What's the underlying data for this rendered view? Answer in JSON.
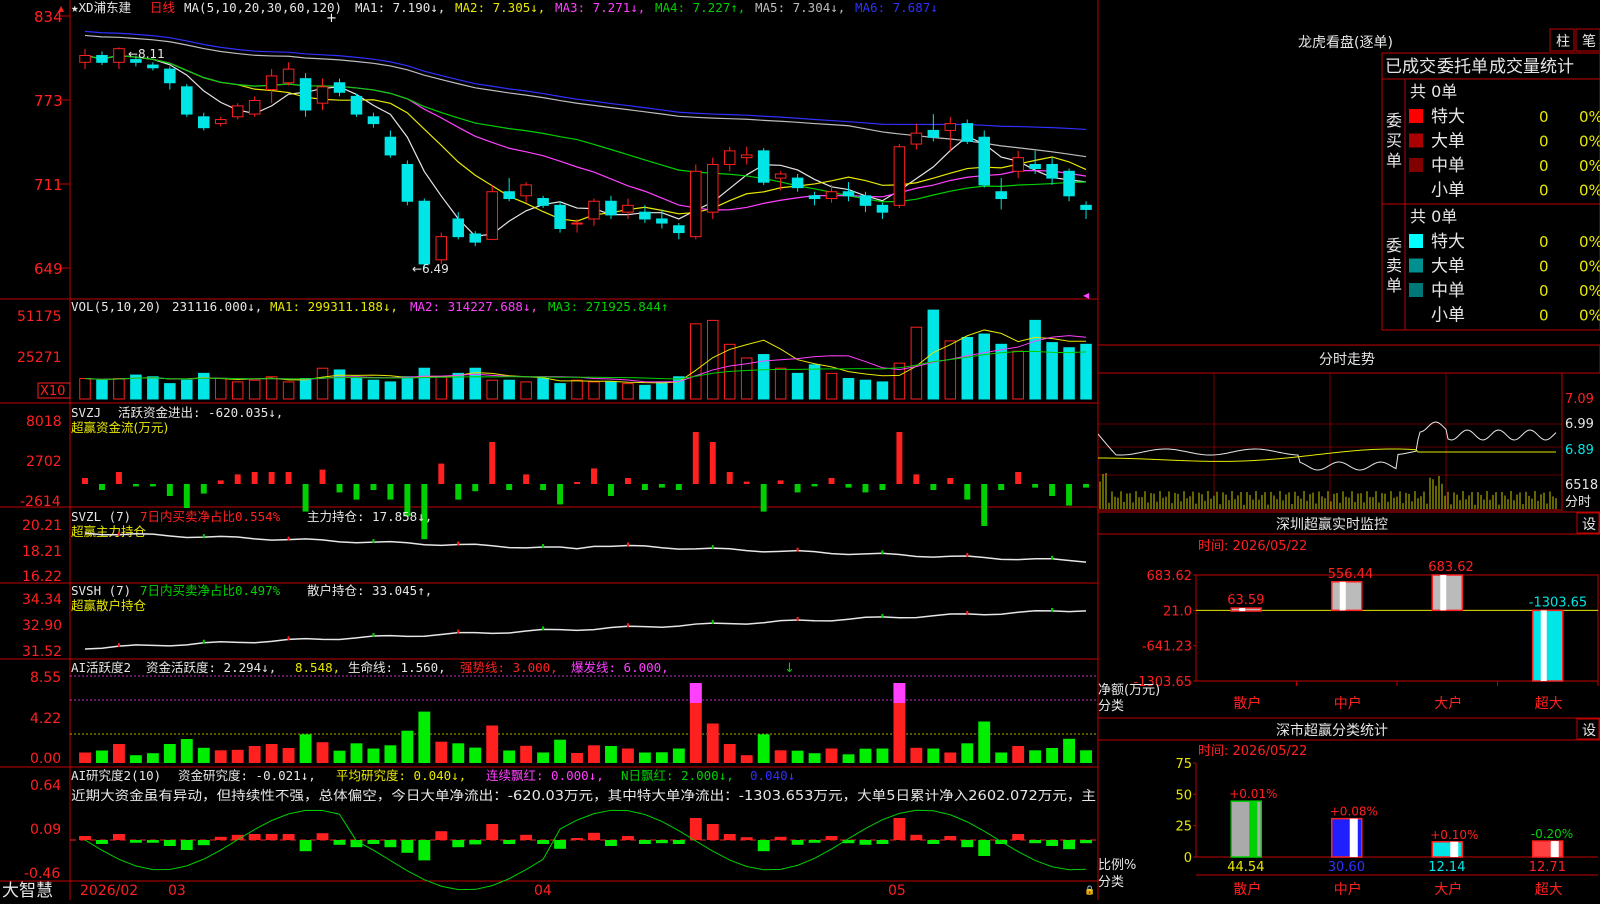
{
  "app": {
    "brand": "大智慧"
  },
  "colors": {
    "up": "#ff2020",
    "down": "#00e5e5",
    "grid": "#c00000",
    "bg": "#000000",
    "white": "#e6e6e6",
    "yellow": "#e8e800",
    "magenta": "#ff40ff",
    "green": "#00d000",
    "blue": "#3030ff",
    "gray": "#bdbdbd"
  },
  "kline": {
    "header": {
      "name": "★XD浦东建",
      "period": "日线",
      "ma_label": "MA(5,10,20,30,60,120)",
      "ma1": "MA1: 7.190↓,",
      "ma2": "MA2: 7.305↓,",
      "ma3": "MA3: 7.271↓,",
      "ma4": "MA4: 7.227↑,",
      "ma5": "MA5: 7.304↓,",
      "ma6": "MA6: 7.687↓"
    },
    "price_axis": [
      "834",
      "773",
      "711",
      "649"
    ],
    "high_label": "←8.11",
    "low_label": "←6.49",
    "months": [
      "2026/02",
      "03",
      "04",
      "05"
    ],
    "candles": [
      [
        8.0,
        8.1,
        7.95,
        8.05
      ],
      [
        8.05,
        8.08,
        7.98,
        8.0
      ],
      [
        8.0,
        8.11,
        7.95,
        8.1
      ],
      [
        8.02,
        8.05,
        7.97,
        8.0
      ],
      [
        7.98,
        8.0,
        7.94,
        7.96
      ],
      [
        7.95,
        7.97,
        7.8,
        7.85
      ],
      [
        7.82,
        7.84,
        7.6,
        7.62
      ],
      [
        7.6,
        7.63,
        7.5,
        7.52
      ],
      [
        7.55,
        7.6,
        7.53,
        7.58
      ],
      [
        7.6,
        7.7,
        7.58,
        7.68
      ],
      [
        7.62,
        7.75,
        7.6,
        7.72
      ],
      [
        7.8,
        7.95,
        7.7,
        7.9
      ],
      [
        7.85,
        8.0,
        7.83,
        7.95
      ],
      [
        7.88,
        7.92,
        7.6,
        7.65
      ],
      [
        7.7,
        7.88,
        7.65,
        7.82
      ],
      [
        7.85,
        7.88,
        7.75,
        7.78
      ],
      [
        7.75,
        7.77,
        7.6,
        7.62
      ],
      [
        7.6,
        7.63,
        7.52,
        7.55
      ],
      [
        7.45,
        7.5,
        7.3,
        7.32
      ],
      [
        7.25,
        7.28,
        6.95,
        6.98
      ],
      [
        6.98,
        7.0,
        6.49,
        6.52
      ],
      [
        6.55,
        6.75,
        6.52,
        6.72
      ],
      [
        6.85,
        6.9,
        6.7,
        6.72
      ],
      [
        6.74,
        6.76,
        6.65,
        6.68
      ],
      [
        6.7,
        7.1,
        6.7,
        7.05
      ],
      [
        7.05,
        7.15,
        6.98,
        7.0
      ],
      [
        7.02,
        7.12,
        6.97,
        7.1
      ],
      [
        7.0,
        7.02,
        6.93,
        6.95
      ],
      [
        6.95,
        6.98,
        6.75,
        6.78
      ],
      [
        6.82,
        6.85,
        6.75,
        6.82
      ],
      [
        6.85,
        7.0,
        6.8,
        6.98
      ],
      [
        6.98,
        7.02,
        6.85,
        6.88
      ],
      [
        6.9,
        7.0,
        6.85,
        6.95
      ],
      [
        6.9,
        6.95,
        6.82,
        6.85
      ],
      [
        6.85,
        6.92,
        6.78,
        6.82
      ],
      [
        6.8,
        6.82,
        6.7,
        6.75
      ],
      [
        6.72,
        7.25,
        6.7,
        7.2
      ],
      [
        6.9,
        7.3,
        6.85,
        7.25
      ],
      [
        7.25,
        7.38,
        7.2,
        7.35
      ],
      [
        7.3,
        7.38,
        7.25,
        7.32
      ],
      [
        7.35,
        7.37,
        7.1,
        7.12
      ],
      [
        7.15,
        7.2,
        7.06,
        7.18
      ],
      [
        7.15,
        7.18,
        7.05,
        7.08
      ],
      [
        7.02,
        7.05,
        6.95,
        7.0
      ],
      [
        7.0,
        7.1,
        6.97,
        7.05
      ],
      [
        7.05,
        7.12,
        6.98,
        7.02
      ],
      [
        7.02,
        7.05,
        6.9,
        6.95
      ],
      [
        6.95,
        6.97,
        6.85,
        6.9
      ],
      [
        6.95,
        7.4,
        6.93,
        7.38
      ],
      [
        7.4,
        7.55,
        7.36,
        7.48
      ],
      [
        7.5,
        7.62,
        7.42,
        7.45
      ],
      [
        7.5,
        7.6,
        7.35,
        7.55
      ],
      [
        7.55,
        7.58,
        7.4,
        7.42
      ],
      [
        7.45,
        7.5,
        7.08,
        7.1
      ],
      [
        7.05,
        7.15,
        6.92,
        7.0
      ],
      [
        7.2,
        7.35,
        7.15,
        7.3
      ],
      [
        7.25,
        7.35,
        7.18,
        7.22
      ],
      [
        7.25,
        7.3,
        7.1,
        7.15
      ],
      [
        7.2,
        7.22,
        6.98,
        7.02
      ],
      [
        6.95,
        6.98,
        6.85,
        6.92
      ]
    ]
  },
  "vol": {
    "header": {
      "label": "VOL(5,10,20)",
      "value": "231116.000↓,",
      "ma1": "MA1: 299311.188↓,",
      "ma2": "MA2: 314227.688↓,",
      "ma3": "MA3: 271925.844↑"
    },
    "axis": [
      "51175",
      "25271"
    ],
    "unit": "X10",
    "values": [
      12000,
      11000,
      12000,
      14000,
      13000,
      9000,
      11000,
      15000,
      12000,
      10000,
      11000,
      13000,
      10000,
      12000,
      18000,
      17000,
      12000,
      11000,
      10000,
      13000,
      18000,
      13000,
      15000,
      18000,
      11000,
      11000,
      10000,
      12000,
      9000,
      11000,
      10000,
      10000,
      9000,
      8000,
      10000,
      13000,
      44000,
      46000,
      32000,
      24000,
      26000,
      18000,
      15000,
      20000,
      15000,
      12000,
      11000,
      10000,
      21000,
      42000,
      52000,
      34000,
      36000,
      38000,
      32000,
      28000,
      46000,
      33000,
      30000,
      32000,
      25000
    ]
  },
  "svzj": {
    "title": "SVZJ",
    "label": "活跃资金进出: -620.035↓,",
    "sub": "超赢资金流(万元)",
    "axis": [
      "8018",
      "2702",
      "-2614"
    ]
  },
  "svzl": {
    "title": "SVZL (7)",
    "label1": "7日内买卖净占比0.554%",
    "label2": "主力持仓: 17.858↓,",
    "sub": "超赢主力持仓",
    "axis": [
      "20.21",
      "18.21",
      "16.22"
    ]
  },
  "svsh": {
    "title": "SVSH (7)",
    "label1": "7日内买卖净占比0.497%",
    "label2": "散户持仓: 33.045↑,",
    "sub": "超赢散户持仓",
    "axis": [
      "34.34",
      "32.90",
      "31.52"
    ]
  },
  "ai1": {
    "title": "AI活跃度2",
    "l1": "资金活跃度: 2.294↓,",
    "l2": "8.548,",
    "l3": "生命线: 1.560,",
    "l4": "强势线: 3.000,",
    "l5": "爆发线: 6.000,",
    "axis": [
      "8.55",
      "4.22",
      "0.00"
    ]
  },
  "ai2": {
    "title": "AI研究度2(10)",
    "l1": "资金研究度: -0.021↓,",
    "l2": "平均研究度: 0.040↓,",
    "l3": "连续飘红: 0.000↓,",
    "l4": "N日飘红: 2.000↓,",
    "l5": "0.040↓",
    "comment": "近期大资金虽有异动，但持续性不强，总体偏空，今日大单净流出：-620.03万元，其中特大单净流出：-1303.653万元，大单5日累计净入2602.072万元，主",
    "axis": [
      "0.64",
      "0.09",
      "-0.46"
    ]
  },
  "panel_dragon": {
    "title": "龙虎看盘(逐单)",
    "btn_bar": "柱",
    "btn_pen": "笔",
    "tab1": "已成交",
    "tab2": "委托单",
    "tab3": "成交量统计",
    "buy": {
      "group": "委买单",
      "total": "共 0单",
      "rows": [
        {
          "label": "特大",
          "value": "0",
          "pct": "0%",
          "color": "#ff0000"
        },
        {
          "label": "大单",
          "value": "0",
          "pct": "0%",
          "color": "#aa0000"
        },
        {
          "label": "中单",
          "value": "0",
          "pct": "0%",
          "color": "#800000"
        },
        {
          "label": "小单",
          "value": "0",
          "pct": "0%",
          "color": "#000000"
        }
      ]
    },
    "sell": {
      "group": "委卖单",
      "total": "共 0单",
      "rows": [
        {
          "label": "特大",
          "value": "0",
          "pct": "0%",
          "color": "#00ffff"
        },
        {
          "label": "大单",
          "value": "0",
          "pct": "0%",
          "color": "#009090"
        },
        {
          "label": "中单",
          "value": "0",
          "pct": "0%",
          "color": "#007878"
        },
        {
          "label": "小单",
          "value": "0",
          "pct": "0%",
          "color": "#000000"
        }
      ]
    }
  },
  "panel_minute": {
    "title": "分时走势",
    "axis": [
      "7.09",
      "6.99",
      "6.89"
    ],
    "vol_axis": "6518",
    "unit": "分时"
  },
  "panel_monitor": {
    "title": "深圳超赢实时监控",
    "settings": "设",
    "time": "时间: 2026/05/22",
    "axis": [
      "683.62",
      "21.0",
      "-641.23",
      "-1303.65"
    ],
    "ylabel": "净额(万元)",
    "xlabel": "分类",
    "categories": [
      "散户",
      "中户",
      "大户",
      "超大"
    ],
    "values": [
      63.59,
      556.44,
      683.62,
      -1303.65
    ],
    "value_labels": [
      "63.59",
      "556.44",
      "683.62",
      "-1303.65"
    ]
  },
  "panel_stats": {
    "title": "深市超赢分类统计",
    "settings": "设",
    "time": "时间: 2026/05/22",
    "axis": [
      "75",
      "50",
      "25",
      "0"
    ],
    "ylabel": "比例%",
    "xlabel": "分类",
    "categories": [
      "散户",
      "中户",
      "大户",
      "超大"
    ],
    "values": [
      44.54,
      30.6,
      12.14,
      12.71
    ],
    "changes": [
      "+0.01%",
      "+0.08%",
      "+0.10%",
      "-0.20%"
    ],
    "bottom_labels": [
      "44.54",
      "30.60",
      "12.14",
      "12.71"
    ]
  }
}
